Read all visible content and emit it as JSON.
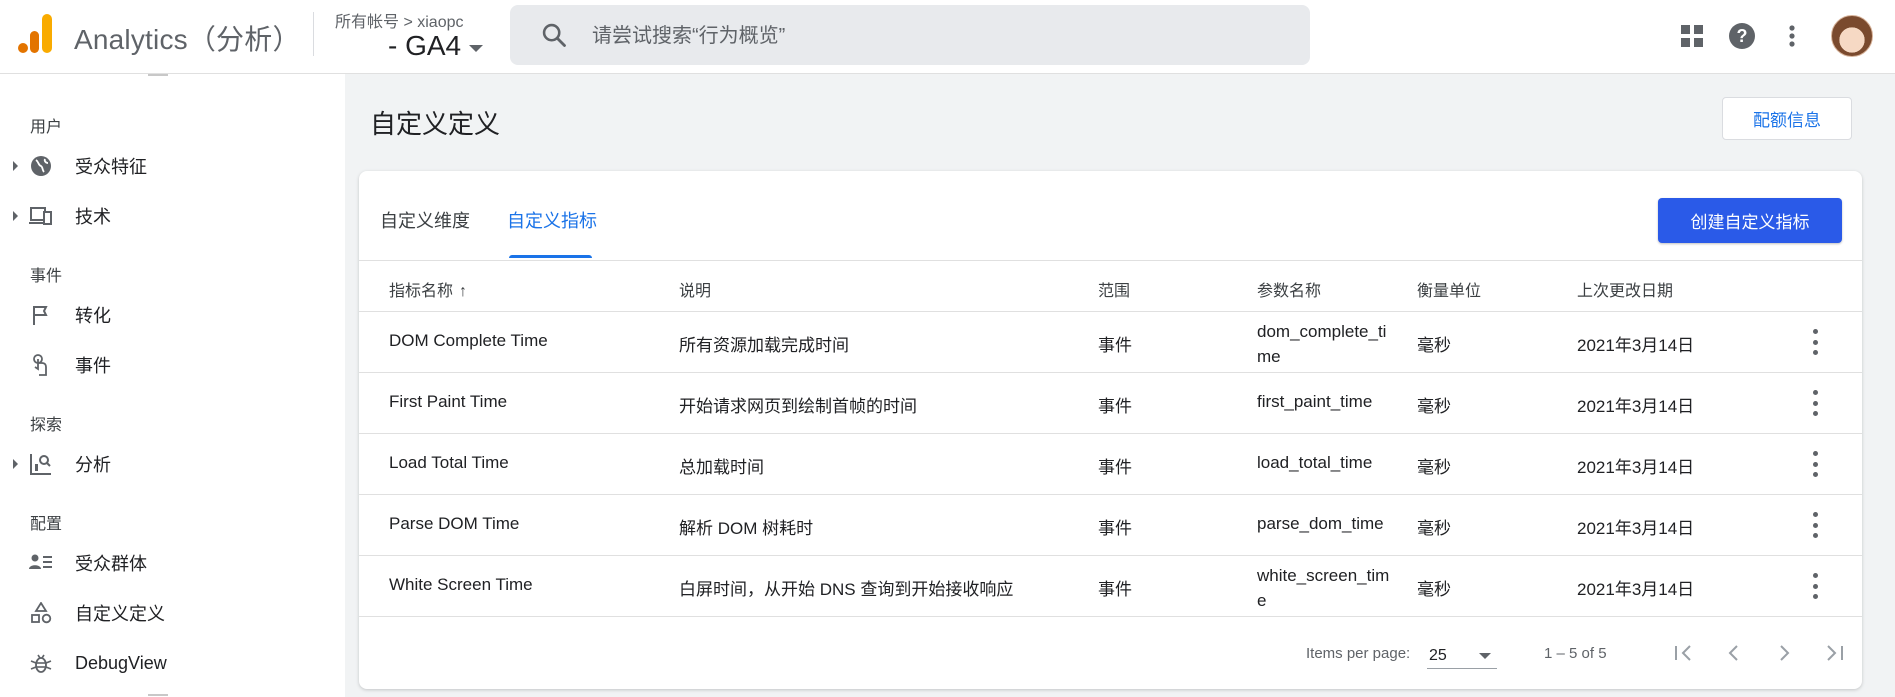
{
  "topbar": {
    "app_title": "Analytics（分析）",
    "account_crumb": "所有帐号 > xiaopc",
    "property": "- GA4",
    "search_placeholder": "请尝试搜索“行为概览”",
    "actions": [
      {
        "name": "apps-icon"
      },
      {
        "name": "help-icon"
      },
      {
        "name": "more-vert-icon"
      }
    ]
  },
  "sidebar": {
    "sections": {
      "user": "用户",
      "event": "事件",
      "explore": "探索",
      "config": "配置"
    },
    "items": [
      {
        "label": "受众特征",
        "icon": "globe-icon"
      },
      {
        "label": "技术",
        "icon": "devices-icon"
      },
      {
        "label": "转化",
        "icon": "flag-icon"
      },
      {
        "label": "事件",
        "icon": "touch-icon"
      },
      {
        "label": "分析",
        "icon": "explore-icon"
      },
      {
        "label": "受众群体",
        "icon": "audience-icon"
      },
      {
        "label": "自定义定义",
        "icon": "shapes-icon"
      },
      {
        "label": "DebugView",
        "icon": "bug-icon"
      }
    ]
  },
  "main": {
    "page_title": "自定义定义",
    "quota_button": "配额信息",
    "tabs": [
      {
        "label": "自定义维度",
        "active": false
      },
      {
        "label": "自定义指标",
        "active": true
      }
    ],
    "create_button": "创建自定义指标",
    "columns": [
      "指标名称",
      "说明",
      "范围",
      "参数名称",
      "衡量单位",
      "上次更改日期"
    ],
    "sort_indicator": "↑",
    "rows": [
      {
        "name": "DOM Complete Time",
        "desc": "所有资源加载完成时间",
        "scope": "事件",
        "param": "dom_complete_time",
        "unit": "毫秒",
        "date": "2021年3月14日"
      },
      {
        "name": "First Paint Time",
        "desc": "开始请求网页到绘制首帧的时间",
        "scope": "事件",
        "param": "first_paint_time",
        "unit": "毫秒",
        "date": "2021年3月14日"
      },
      {
        "name": "Load Total Time",
        "desc": "总加载时间",
        "scope": "事件",
        "param": "load_total_time",
        "unit": "毫秒",
        "date": "2021年3月14日"
      },
      {
        "name": "Parse DOM Time",
        "desc": "解析 DOM 树耗时",
        "scope": "事件",
        "param": "parse_dom_time",
        "unit": "毫秒",
        "date": "2021年3月14日"
      },
      {
        "name": "White Screen Time",
        "desc": "白屏时间，从开始 DNS 查询到开始接收响应",
        "scope": "事件",
        "param": "white_screen_time",
        "unit": "毫秒",
        "date": "2021年3月14日"
      }
    ],
    "footer": {
      "items_per_page_label": "Items per page:",
      "items_per_page": "25",
      "range": "1 – 5 of 5"
    }
  },
  "colors": {
    "accent": "#1a73e8",
    "primary_button": "#2a5ae8",
    "logo_orange": "#f9ab00",
    "logo_dark_orange": "#e37400"
  }
}
